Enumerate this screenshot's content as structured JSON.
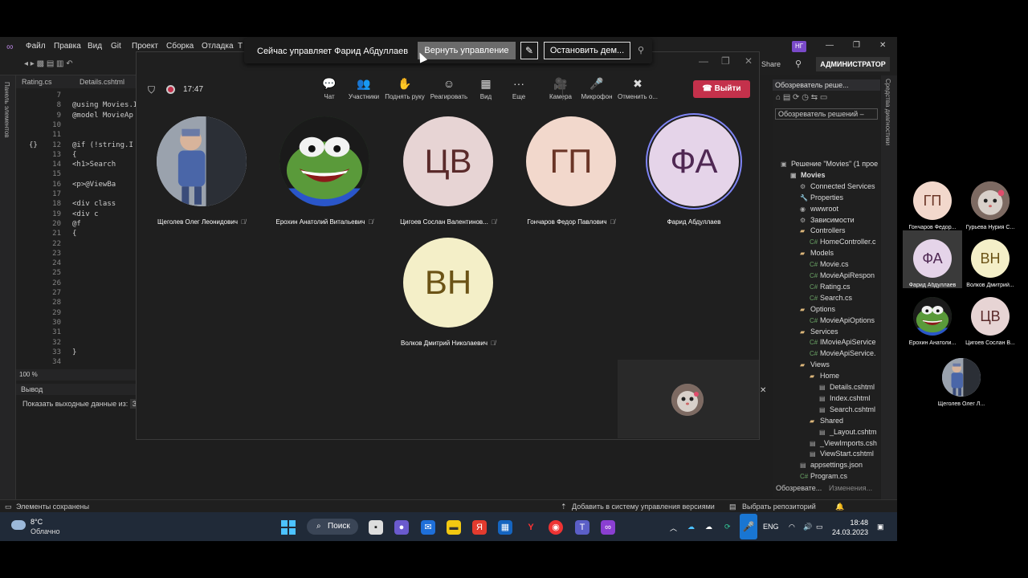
{
  "vs": {
    "menu": [
      "Файл",
      "Правка",
      "Вид",
      "Git",
      "Проект",
      "Сборка",
      "Отладка",
      "Т"
    ],
    "user_badge": "НГ",
    "share_label": "Share",
    "admin_label": "АДМИНИСТРАТОР",
    "left_strip_label": "Панель элементов",
    "tabs": [
      "Rating.cs",
      "Details.cshtml"
    ],
    "code_lines": [
      {
        "n": "7",
        "t": ""
      },
      {
        "n": "8",
        "t": "@using Movies.I"
      },
      {
        "n": "9",
        "t": "@model MovieAp"
      },
      {
        "n": "10",
        "t": ""
      },
      {
        "n": "11",
        "t": ""
      },
      {
        "n": "12",
        "t": "@if (!string.I"
      },
      {
        "n": "13",
        "t": "{"
      },
      {
        "n": "14",
        "t": "  <h1>Search"
      },
      {
        "n": "15",
        "t": ""
      },
      {
        "n": "16",
        "t": "  <p>@ViewBa"
      },
      {
        "n": "17",
        "t": ""
      },
      {
        "n": "18",
        "t": "  <div class"
      },
      {
        "n": "19",
        "t": "    <div c"
      },
      {
        "n": "20",
        "t": "      @f"
      },
      {
        "n": "21",
        "t": "      {"
      },
      {
        "n": "22",
        "t": ""
      },
      {
        "n": "23",
        "t": ""
      },
      {
        "n": "24",
        "t": ""
      },
      {
        "n": "25",
        "t": ""
      },
      {
        "n": "26",
        "t": ""
      },
      {
        "n": "27",
        "t": ""
      },
      {
        "n": "28",
        "t": ""
      },
      {
        "n": "29",
        "t": ""
      },
      {
        "n": "30",
        "t": ""
      },
      {
        "n": "31",
        "t": ""
      },
      {
        "n": "32",
        "t": ""
      },
      {
        "n": "33",
        "t": "      }"
      },
      {
        "n": "34",
        "t": ""
      }
    ],
    "zoom": "100 %",
    "output_title": "Вывод",
    "output_source_label": "Показать выходные данные из:",
    "output_source_value": "За",
    "solution_title": "Обозреватель реше...",
    "solution_search": "Обозреватель решений –",
    "tree": [
      {
        "label": "Решение \"Movies\" (1 прое",
        "indent": 0,
        "icon": "▣"
      },
      {
        "label": "Movies",
        "indent": 1,
        "icon": "▣",
        "bold": true
      },
      {
        "label": "Connected Services",
        "indent": 2,
        "icon": "⚙"
      },
      {
        "label": "Properties",
        "indent": 2,
        "icon": "🔧"
      },
      {
        "label": "wwwroot",
        "indent": 2,
        "icon": "◉"
      },
      {
        "label": "Зависимости",
        "indent": 2,
        "icon": "⚙"
      },
      {
        "label": "Controllers",
        "indent": 2,
        "icon": "▰"
      },
      {
        "label": "HomeController.c",
        "indent": 3,
        "icon": "C#"
      },
      {
        "label": "Models",
        "indent": 2,
        "icon": "▰"
      },
      {
        "label": "Movie.cs",
        "indent": 3,
        "icon": "C#"
      },
      {
        "label": "MovieApiRespon",
        "indent": 3,
        "icon": "C#"
      },
      {
        "label": "Rating.cs",
        "indent": 3,
        "icon": "C#"
      },
      {
        "label": "Search.cs",
        "indent": 3,
        "icon": "C#"
      },
      {
        "label": "Options",
        "indent": 2,
        "icon": "▰"
      },
      {
        "label": "MovieApiOptions",
        "indent": 3,
        "icon": "C#"
      },
      {
        "label": "Services",
        "indent": 2,
        "icon": "▰"
      },
      {
        "label": "IMovieApiService",
        "indent": 3,
        "icon": "C#"
      },
      {
        "label": "MovieApiService.",
        "indent": 3,
        "icon": "C#"
      },
      {
        "label": "Views",
        "indent": 2,
        "icon": "▰"
      },
      {
        "label": "Home",
        "indent": 3,
        "icon": "▰"
      },
      {
        "label": "Details.cshtml",
        "indent": 4,
        "icon": "▤"
      },
      {
        "label": "Index.cshtml",
        "indent": 4,
        "icon": "▤"
      },
      {
        "label": "Search.cshtml",
        "indent": 4,
        "icon": "▤"
      },
      {
        "label": "Shared",
        "indent": 3,
        "icon": "▰"
      },
      {
        "label": "_Layout.cshtm",
        "indent": 4,
        "icon": "▤"
      },
      {
        "label": "_ViewImports.csh",
        "indent": 3,
        "icon": "▤"
      },
      {
        "label": "ViewStart.cshtml",
        "indent": 3,
        "icon": "▤"
      },
      {
        "label": "appsettings.json",
        "indent": 2,
        "icon": "▤"
      },
      {
        "label": "Program.cs",
        "indent": 2,
        "icon": "C#"
      }
    ],
    "solution_tabs": [
      "Обозревате...",
      "Изменения..."
    ],
    "diag_label": "Средства диагностики",
    "status_left": "Элементы сохранены",
    "status_git": "Добавить в систему управления версиями",
    "status_repo": "Выбрать репозиторий"
  },
  "taskbar": {
    "temp": "8°C",
    "weather": "Облачно",
    "search": "Поиск",
    "lang": "ENG",
    "time": "18:48",
    "date": "24.03.2023"
  },
  "share_banner": {
    "text": "Сейчас управляет Фарид Абдуллаев",
    "return_label": "Вернуть управление",
    "stop_label": "Остановить дем..."
  },
  "teams": {
    "timer": "17:47",
    "buttons": [
      {
        "label": "Чат",
        "glyph": "💬"
      },
      {
        "label": "Участники",
        "glyph": "👥"
      },
      {
        "label": "Поднять руку",
        "glyph": "✋"
      },
      {
        "label": "Реагировать",
        "glyph": "☺"
      },
      {
        "label": "Вид",
        "glyph": "▦"
      },
      {
        "label": "Еще",
        "glyph": "···"
      },
      {
        "label": "Камера",
        "glyph": "🎥"
      },
      {
        "label": "Микрофон",
        "glyph": "🎤"
      },
      {
        "label": "Отменить о...",
        "glyph": "✖"
      }
    ],
    "leave_label": "Выйти",
    "participants": [
      {
        "name": "Щеголев Олег Леонидович",
        "initials": "",
        "bg": "#c9ccd4",
        "fg": "#5a3a1a",
        "photo": "child"
      },
      {
        "name": "Ерохин Анатолий Витальевич",
        "initials": "",
        "bg": "#2f6d2c",
        "fg": "#fff",
        "photo": "frog"
      },
      {
        "name": "Цигоев Сослан Валентинов...",
        "initials": "ЦВ",
        "bg": "#e7d4d4",
        "fg": "#5a2a2a"
      },
      {
        "name": "Гончаров Федор Павлович",
        "initials": "ГП",
        "bg": "#f2d8cc",
        "fg": "#6a3526"
      },
      {
        "name": "Фарид Абдуллаев",
        "initials": "ФА",
        "bg": "#e5d4e9",
        "fg": "#4f2853",
        "active": true
      },
      {
        "name": "Волков Дмитрий Николаевич",
        "initials": "ВН",
        "bg": "#f4efc8",
        "fg": "#6b5316"
      }
    ]
  },
  "float_panel": [
    {
      "name": "Гончаров Федор...",
      "initials": "ГП",
      "bg": "#f2d8cc",
      "fg": "#6a3526"
    },
    {
      "name": "Гурьева Нурия С...",
      "initials": "",
      "bg": "#8a7a7a",
      "fg": "#fff",
      "photo": "cat"
    },
    {
      "name": "Фарид Абдуллаев",
      "initials": "ФА",
      "bg": "#e5d4e9",
      "fg": "#4f2853"
    },
    {
      "name": "Волков Дмитрий...",
      "initials": "ВН",
      "bg": "#f4efc8",
      "fg": "#6b5316"
    },
    {
      "name": "Ерохин Анатоли...",
      "initials": "",
      "bg": "#2f6d2c",
      "fg": "#fff",
      "photo": "frog"
    },
    {
      "name": "Цигоев Сослан В...",
      "initials": "ЦВ",
      "bg": "#e7d4d4",
      "fg": "#5a2a2a"
    },
    {
      "name": "Щеголев Олег Л...",
      "initials": "",
      "bg": "#c9ccd4",
      "fg": "#fff",
      "photo": "child"
    }
  ]
}
